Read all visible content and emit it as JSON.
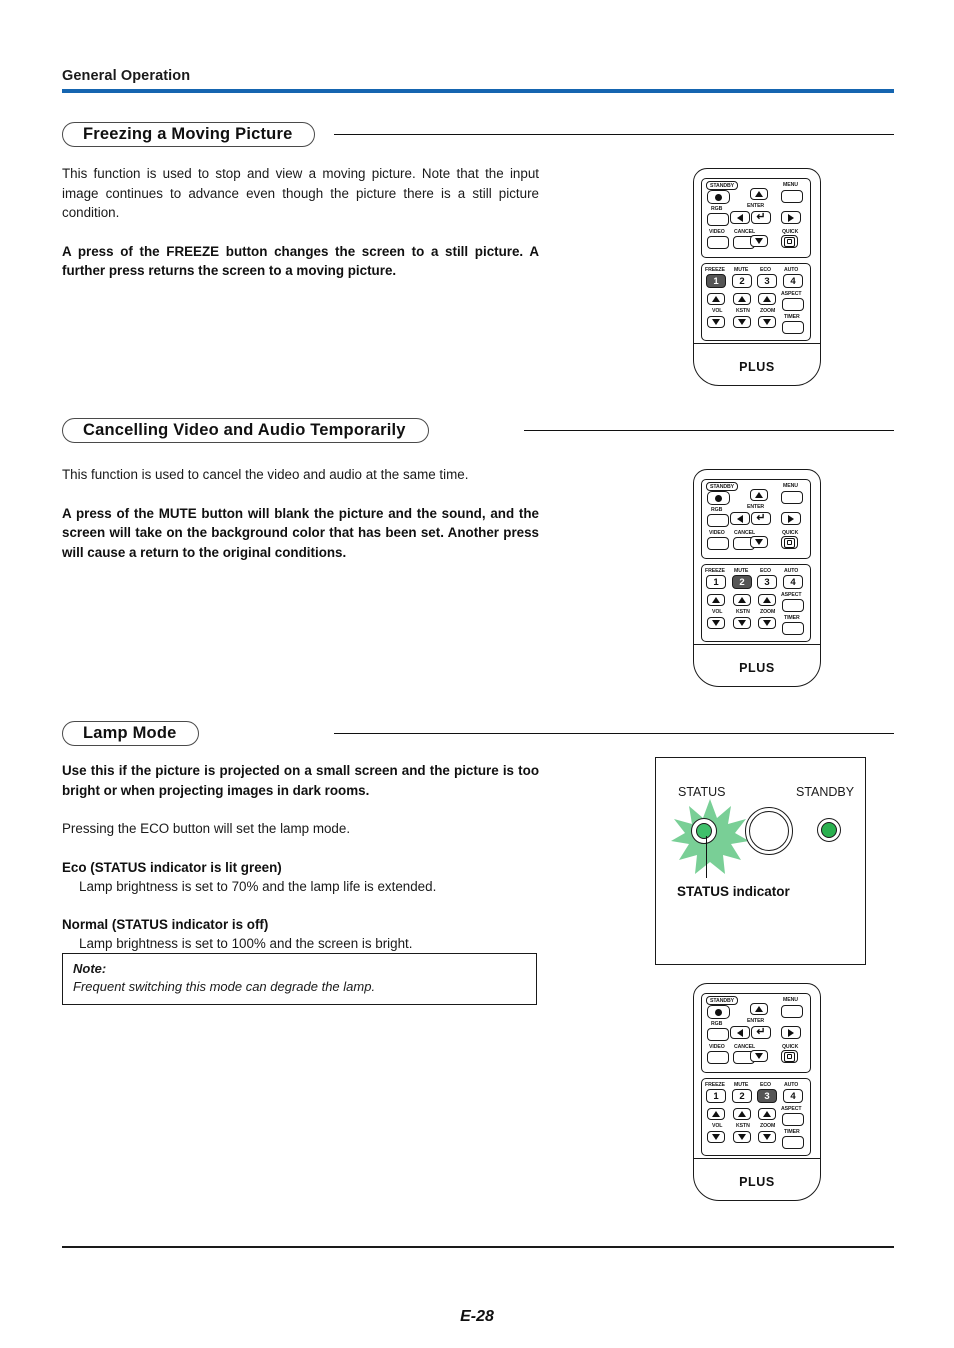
{
  "header": {
    "title": "General Operation",
    "rule_color": "#1565b0"
  },
  "sections": [
    {
      "heading": "Freezing a Moving Picture",
      "paragraphs": [
        "This function is used to stop and view a moving picture. Note that the input image continues to advance even though the picture there is a still picture condition.",
        "A press of the FREEZE button changes the screen to a still picture. A further press returns the screen to a moving picture."
      ]
    },
    {
      "heading": "Cancelling Video and Audio Temporarily",
      "paragraphs": [
        "This function is used to cancel the video and audio at the same time.",
        "A press of the MUTE button will blank the picture and the sound, and the screen will take on the background color that has been set. Another press will cause a return to the original conditions."
      ]
    },
    {
      "heading": "Lamp Mode",
      "paragraphs": [
        "Use this if the picture is projected on a small screen and the picture is too bright or when projecting images in dark rooms.",
        "Pressing the ECO button will set the lamp mode."
      ],
      "modes": [
        {
          "title": "Eco (STATUS indicator is lit green)",
          "desc": "Lamp brightness is set to 70% and the lamp life is extended."
        },
        {
          "title": "Normal (STATUS indicator is off)",
          "desc": "Lamp brightness is set to 100% and the screen is bright."
        }
      ],
      "note": {
        "title": "Note:",
        "text": "Frequent switching this mode can degrade the lamp."
      }
    }
  ],
  "remote": {
    "brand": "PLUS",
    "labels": {
      "standby": "STANDBY",
      "menu": "MENU",
      "rgb": "RGB",
      "enter": "ENTER",
      "video": "VIDEO",
      "cancel": "CANCEL",
      "quick": "QUICK",
      "freeze": "FREEZE",
      "mute": "MUTE",
      "eco": "ECO",
      "auto": "AUTO",
      "aspect": "ASPECT",
      "vol": "VOL",
      "kstn": "KSTN",
      "zoom": "ZOOM",
      "timer": "TIMER"
    },
    "numbers": {
      "freeze": "1",
      "mute": "2",
      "eco": "3",
      "auto": "4"
    },
    "highlight_color": "#555555"
  },
  "remote_instances": [
    {
      "id": "remote-freeze",
      "highlighted_key": "1"
    },
    {
      "id": "remote-mute",
      "highlighted_key": "2"
    },
    {
      "id": "remote-eco",
      "highlighted_key": "3"
    }
  ],
  "status_panel": {
    "status_label": "STATUS",
    "standby_label": "STANDBY",
    "callout": "STATUS indicator",
    "status_led_color": "#3fbf6a",
    "standby_led_color": "#2ab04f"
  },
  "footer": {
    "page": "E-28"
  }
}
